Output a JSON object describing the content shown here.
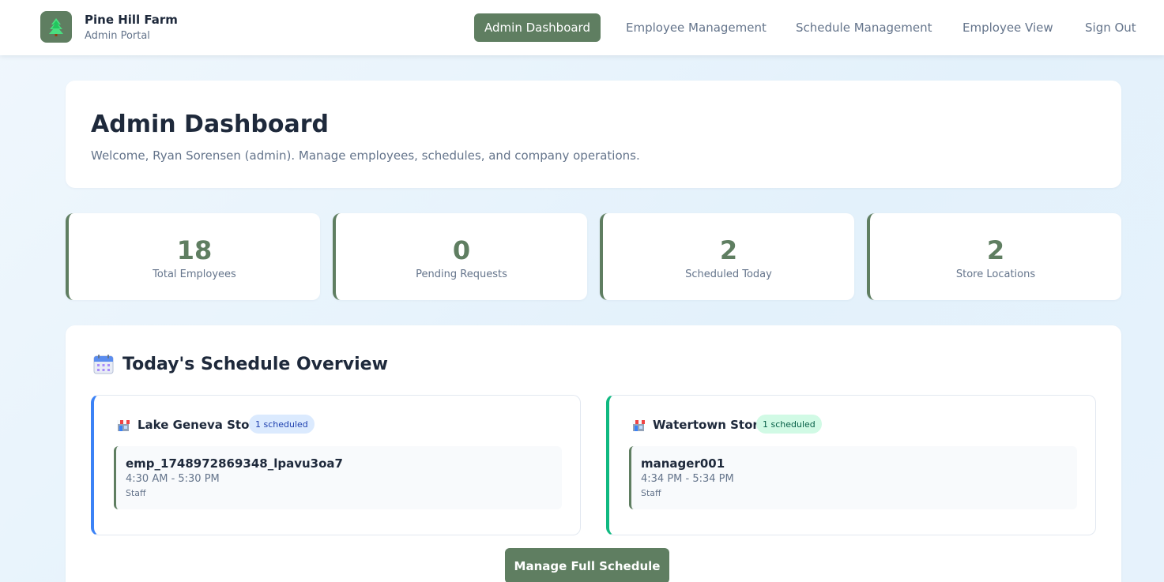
{
  "brand": {
    "name": "Pine Hill Farm",
    "subtitle": "Admin Portal",
    "logo_icon": "pine-tree-icon"
  },
  "nav": {
    "items": [
      {
        "label": "Admin Dashboard",
        "active": true
      },
      {
        "label": "Employee Management",
        "active": false
      },
      {
        "label": "Schedule Management",
        "active": false
      },
      {
        "label": "Employee View",
        "active": false
      },
      {
        "label": "Sign Out",
        "active": false
      }
    ]
  },
  "page": {
    "title": "Admin Dashboard",
    "welcome": "Welcome, Ryan Sorensen (admin). Manage employees, schedules, and company operations."
  },
  "stats": [
    {
      "value": "18",
      "label": "Total Employees"
    },
    {
      "value": "0",
      "label": "Pending Requests"
    },
    {
      "value": "2",
      "label": "Scheduled Today"
    },
    {
      "value": "2",
      "label": "Store Locations"
    }
  ],
  "overview": {
    "title": "Today's Schedule Overview",
    "icon": "calendar-icon",
    "stores": [
      {
        "name": "Lake Geneva Store",
        "badge": "1 scheduled",
        "icon": "store-icon",
        "shifts": [
          {
            "employee": "emp_1748972869348_lpavu3oa7",
            "time": "4:30 AM - 5:30 PM",
            "role": "Staff"
          }
        ]
      },
      {
        "name": "Watertown Store",
        "badge": "1 scheduled",
        "icon": "store-icon",
        "shifts": [
          {
            "employee": "manager001",
            "time": "4:34 PM - 5:34 PM",
            "role": "Staff"
          }
        ]
      }
    ],
    "manage_button": "Manage Full Schedule"
  },
  "colors": {
    "primary": "#5f7e61",
    "store_blue": "#3b82f6",
    "store_green": "#10b981",
    "text_dark": "#1e293b",
    "text_muted": "#64748b"
  }
}
